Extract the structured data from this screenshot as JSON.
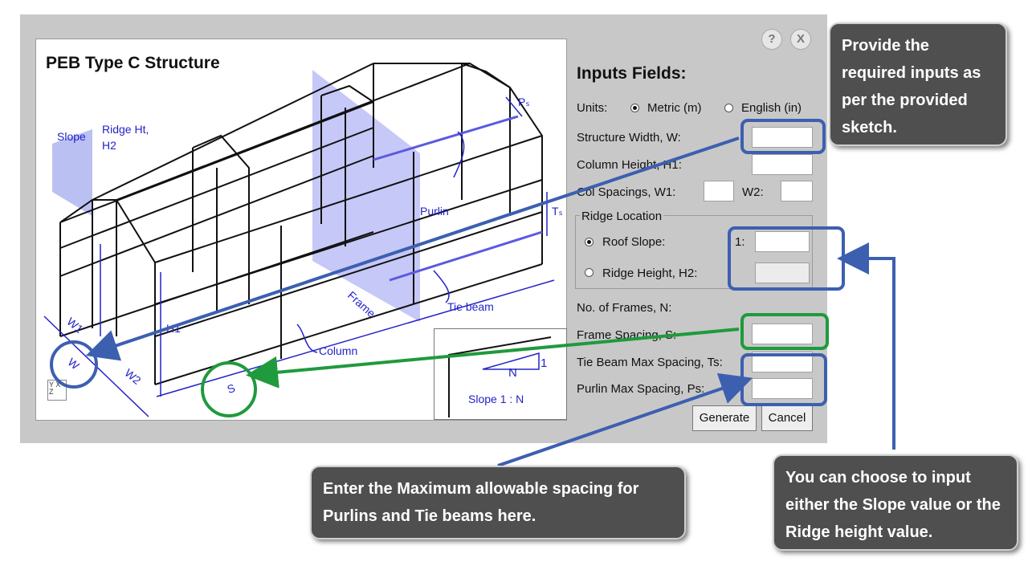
{
  "dialog": {
    "help_label": "?",
    "close_label": "X"
  },
  "sketch": {
    "title": "PEB Type C Structure",
    "labels": {
      "slope": "Slope",
      "ridge_ht": "Ridge Ht,",
      "h2": "H2",
      "purlin": "Purlin",
      "ts": "Tₛ",
      "ps": "Pₛ",
      "frame": "Frame",
      "tie_beam": "Tie beam",
      "column": "Column",
      "h1": "H1",
      "w1": "W1",
      "w2": "W2",
      "w": "W",
      "s": "S"
    },
    "slope_inset": {
      "n": "N",
      "one": "1",
      "text": "Slope   1 : N"
    },
    "axis_icon": "Y  X Z"
  },
  "form": {
    "title": "Inputs Fields:",
    "units_label": "Units:",
    "metric_label": "Metric (m)",
    "english_label": "English (in)",
    "structure_width_label": "Structure Width, W:",
    "column_height_label": "Column Height, H1:",
    "col_spacings_label": "Col Spacings, W1:",
    "w2_label": "W2:",
    "ridge_location_label": "Ridge Location",
    "roof_slope_label": "Roof Slope:",
    "ratio_prefix": "1:",
    "ridge_height_label": "Ridge Height, H2:",
    "frames_label": "No. of Frames, N:",
    "frame_spacing_label": "Frame Spacing, S:",
    "tie_beam_label": "Tie Beam Max Spacing, Ts:",
    "purlin_label": "Purlin Max Spacing, Ps:",
    "values": {
      "structure_width": "",
      "column_height": "",
      "w1": "",
      "w2": "",
      "roof_slope": "",
      "ridge_height": "",
      "frame_spacing": "",
      "tie_beam": "",
      "purlin": ""
    },
    "generate_label": "Generate",
    "cancel_label": "Cancel"
  },
  "callouts": {
    "top_right": "Provide the required inputs as per the provided sketch.",
    "bottom_middle": "Enter the Maximum allowable spacing for Purlins and Tie beams here.",
    "bottom_right": "You can choose to input either the Slope value or the Ridge height value."
  },
  "colors": {
    "blue": "#3d5fb0",
    "green": "#1f9a3c",
    "sketch_blue": "#2323c8",
    "panel_gray": "#c8c8c8",
    "callout_bg": "#4f4f4f"
  }
}
